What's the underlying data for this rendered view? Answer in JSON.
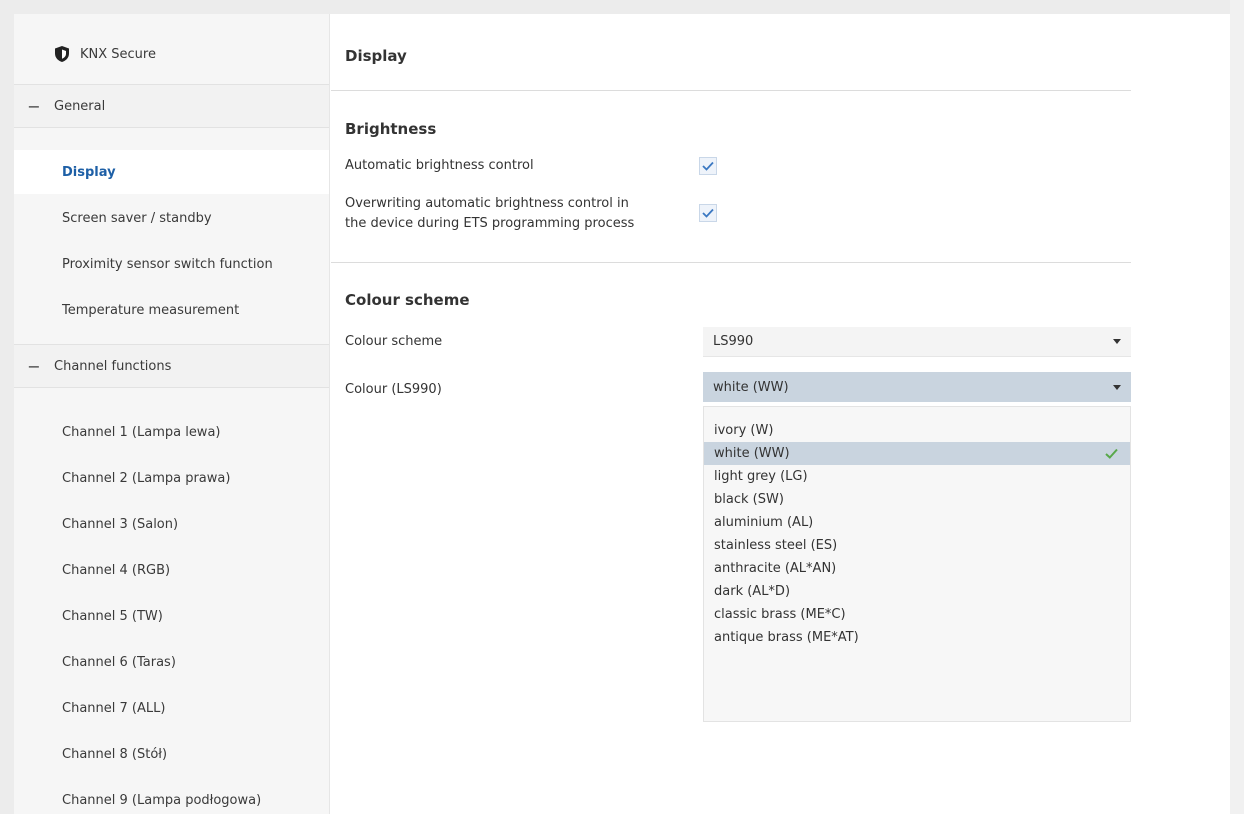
{
  "sidebar": {
    "header": "KNX Secure",
    "general": {
      "collapse": "−",
      "label": "General"
    },
    "general_items": [
      "Display",
      "Screen saver / standby",
      "Proximity sensor switch function",
      "Temperature measurement"
    ],
    "channel_group": {
      "collapse": "−",
      "label": "Channel functions"
    },
    "channels": [
      "Channel 1 (Lampa lewa)",
      "Channel 2 (Lampa prawa)",
      "Channel 3 (Salon)",
      "Channel 4 (RGB)",
      "Channel 5 (TW)",
      "Channel 6 (Taras)",
      "Channel 7 (ALL)",
      "Channel 8 (Stół)",
      "Channel 9 (Lampa podłogowa)"
    ]
  },
  "main": {
    "title": "Display",
    "brightness": {
      "title": "Brightness",
      "auto_label": "Automatic brightness control",
      "auto_checked": true,
      "overwrite_label_line1": "Overwriting automatic brightness control in",
      "overwrite_label_line2": "the device during ETS programming process",
      "overwrite_checked": true
    },
    "colour_scheme": {
      "title": "Colour scheme",
      "scheme_label": "Colour scheme",
      "scheme_value": "LS990",
      "colour_label": "Colour (LS990)",
      "colour_value": "white (WW)",
      "options": [
        "ivory (W)",
        "white (WW)",
        "light grey (LG)",
        "black (SW)",
        "aluminium (AL)",
        "stainless steel (ES)",
        "anthracite (AL*AN)",
        "dark (AL*D)",
        "classic brass (ME*C)",
        "antique brass (ME*AT)"
      ],
      "selected_option": "white (WW)"
    }
  },
  "colors": {
    "accent": "#1d5fa6",
    "check_green": "#58a84a",
    "selection": "#c9d4df"
  }
}
